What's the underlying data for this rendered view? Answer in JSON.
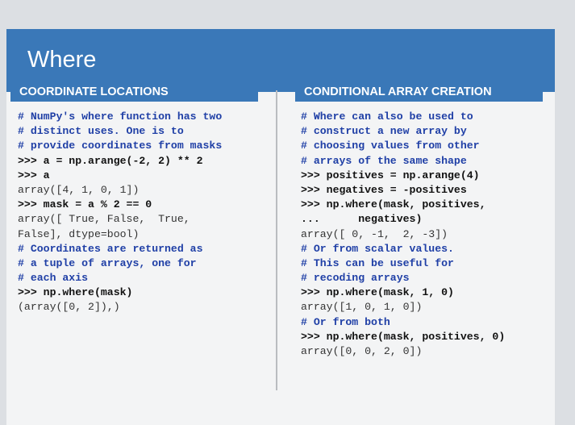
{
  "title": "Where",
  "left_panel": {
    "header": "COORDINATE LOCATIONS",
    "lines": [
      {
        "kind": "comment",
        "text": "# NumPy's where function has two"
      },
      {
        "kind": "comment",
        "text": "# distinct uses. One is to"
      },
      {
        "kind": "comment",
        "text": "# provide coordinates from masks"
      },
      {
        "kind": "input",
        "text": ">>> a = np.arange(-2, 2) ** 2"
      },
      {
        "kind": "input",
        "text": ">>> a"
      },
      {
        "kind": "output",
        "text": "array([4, 1, 0, 1])"
      },
      {
        "kind": "input",
        "text": ">>> mask = a % 2 == 0"
      },
      {
        "kind": "output",
        "text": "array([ True, False,  True,"
      },
      {
        "kind": "output",
        "text": "False], dtype=bool)"
      },
      {
        "kind": "comment",
        "text": "# Coordinates are returned as"
      },
      {
        "kind": "comment",
        "text": "# a tuple of arrays, one for"
      },
      {
        "kind": "comment",
        "text": "# each axis"
      },
      {
        "kind": "input",
        "text": ">>> np.where(mask)"
      },
      {
        "kind": "output",
        "text": "(array([0, 2]),)"
      }
    ]
  },
  "right_panel": {
    "header": "CONDITIONAL ARRAY CREATION",
    "lines": [
      {
        "kind": "comment",
        "text": "# Where can also be used to"
      },
      {
        "kind": "comment",
        "text": "# construct a new array by"
      },
      {
        "kind": "comment",
        "text": "# choosing values from other"
      },
      {
        "kind": "comment",
        "text": "# arrays of the same shape"
      },
      {
        "kind": "input",
        "text": ">>> positives = np.arange(4)"
      },
      {
        "kind": "input",
        "text": ">>> negatives = -positives"
      },
      {
        "kind": "input",
        "text": ">>> np.where(mask, positives,"
      },
      {
        "kind": "input",
        "text": "...      negatives)"
      },
      {
        "kind": "output",
        "text": "array([ 0, -1,  2, -3])"
      },
      {
        "kind": "comment",
        "text": "# Or from scalar values."
      },
      {
        "kind": "comment",
        "text": "# This can be useful for"
      },
      {
        "kind": "comment",
        "text": "# recoding arrays"
      },
      {
        "kind": "input",
        "text": ">>> np.where(mask, 1, 0)"
      },
      {
        "kind": "output",
        "text": "array([1, 0, 1, 0])"
      },
      {
        "kind": "comment",
        "text": "# Or from both"
      },
      {
        "kind": "input",
        "text": ">>> np.where(mask, positives, 0)"
      },
      {
        "kind": "output",
        "text": "array([0, 0, 2, 0])"
      }
    ]
  }
}
